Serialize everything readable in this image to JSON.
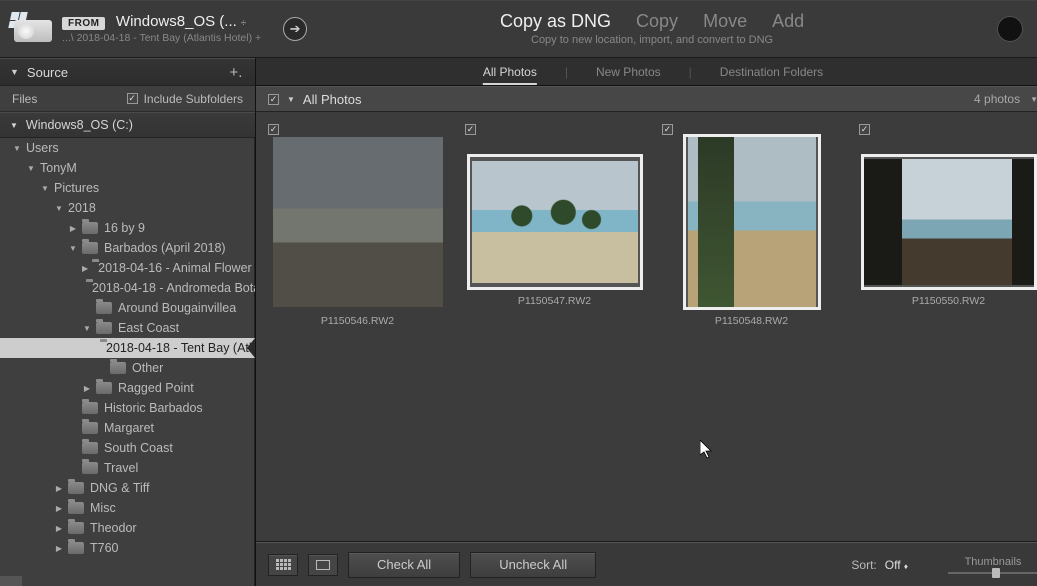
{
  "header": {
    "from_label": "FROM",
    "from_title": "Windows8_OS (...",
    "from_title_caret": "÷",
    "from_sub": "...\\ 2018-04-18 - Tent Bay (Atlantis Hotel) +",
    "copy_active": "Copy as DNG",
    "copy_options": [
      "Copy",
      "Move",
      "Add"
    ],
    "copy_sub": "Copy to new location, import, and convert to DNG"
  },
  "sidebar": {
    "panel_title": "Source",
    "files_label": "Files",
    "include_label": "Include Subfolders",
    "include_checked": true,
    "drive_label": "Windows8_OS (C:)",
    "tree": [
      {
        "depth": 0,
        "exp": "down",
        "hasFolder": false,
        "label": "Users"
      },
      {
        "depth": 1,
        "exp": "down",
        "hasFolder": false,
        "label": "TonyM"
      },
      {
        "depth": 2,
        "exp": "down",
        "hasFolder": false,
        "label": "Pictures"
      },
      {
        "depth": 3,
        "exp": "down",
        "hasFolder": false,
        "label": "2018"
      },
      {
        "depth": 4,
        "exp": "right",
        "hasFolder": true,
        "label": "16 by 9"
      },
      {
        "depth": 4,
        "exp": "down",
        "hasFolder": true,
        "label": "Barbados (April 2018)"
      },
      {
        "depth": 5,
        "exp": "right",
        "hasFolder": true,
        "label": "2018-04-16 - Animal Flower C..."
      },
      {
        "depth": 5,
        "exp": "none",
        "hasFolder": true,
        "label": "2018-04-18 - Andromeda Bota..."
      },
      {
        "depth": 5,
        "exp": "none",
        "hasFolder": true,
        "label": "Around Bougainvillea"
      },
      {
        "depth": 5,
        "exp": "down",
        "hasFolder": true,
        "label": "East Coast"
      },
      {
        "depth": 6,
        "exp": "none",
        "hasFolder": true,
        "label": "2018-04-18 - Tent Bay (Atl...",
        "selected": true
      },
      {
        "depth": 6,
        "exp": "none",
        "hasFolder": true,
        "label": "Other"
      },
      {
        "depth": 5,
        "exp": "right",
        "hasFolder": true,
        "label": "Ragged Point"
      },
      {
        "depth": 4,
        "exp": "none",
        "hasFolder": true,
        "label": "Historic Barbados"
      },
      {
        "depth": 4,
        "exp": "none",
        "hasFolder": true,
        "label": "Margaret"
      },
      {
        "depth": 4,
        "exp": "none",
        "hasFolder": true,
        "label": "South Coast"
      },
      {
        "depth": 4,
        "exp": "none",
        "hasFolder": true,
        "label": "Travel"
      },
      {
        "depth": 3,
        "exp": "right",
        "hasFolder": true,
        "label": "DNG & Tiff"
      },
      {
        "depth": 3,
        "exp": "right",
        "hasFolder": true,
        "label": "Misc"
      },
      {
        "depth": 3,
        "exp": "right",
        "hasFolder": true,
        "label": "Theodor"
      },
      {
        "depth": 3,
        "exp": "right",
        "hasFolder": true,
        "label": "T760"
      }
    ]
  },
  "tabs": {
    "items": [
      "All Photos",
      "New Photos",
      "Destination Folders"
    ],
    "active": 0
  },
  "grid": {
    "header_label": "All Photos",
    "header_checked": true,
    "count_label": "4 photos",
    "cells": [
      {
        "checked": true,
        "filename": "P1150546.RW2",
        "img": "a",
        "frame": "dim",
        "shape": "full"
      },
      {
        "checked": true,
        "filename": "P1150547.RW2",
        "img": "b",
        "frame": "sel",
        "shape": "land"
      },
      {
        "checked": true,
        "filename": "P1150548.RW2",
        "img": "c",
        "frame": "sel",
        "shape": "port"
      },
      {
        "checked": true,
        "filename": "P1150550.RW2",
        "img": "d",
        "frame": "sel",
        "shape": "land"
      }
    ]
  },
  "footer": {
    "check_all": "Check All",
    "uncheck_all": "Uncheck All",
    "sort_label": "Sort:",
    "sort_value": "Off",
    "thumbnails_label": "Thumbnails"
  }
}
